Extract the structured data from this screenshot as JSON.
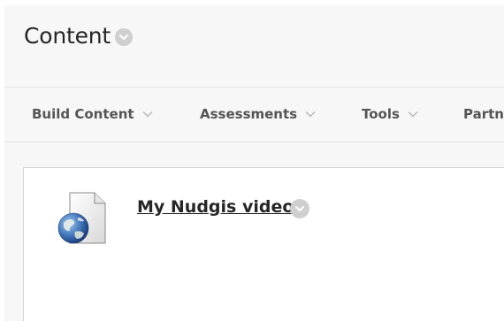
{
  "header": {
    "title": "Content",
    "options_icon": "chevron-down-icon"
  },
  "toolbar": {
    "items": [
      {
        "label": "Build Content",
        "icon": "chevron-down-icon"
      },
      {
        "label": "Assessments",
        "icon": "chevron-down-icon"
      },
      {
        "label": "Tools",
        "icon": "chevron-down-icon"
      },
      {
        "label": "Partn"
      }
    ]
  },
  "content_item": {
    "title": "My Nudgis video",
    "icon": "web-link-globe-icon",
    "options_icon": "chevron-down-icon"
  },
  "colors": {
    "background": "#f7f7f7",
    "card": "#ffffff",
    "text": "#262626",
    "menu_text": "#555555",
    "options_circle": "#cfcfcf"
  }
}
